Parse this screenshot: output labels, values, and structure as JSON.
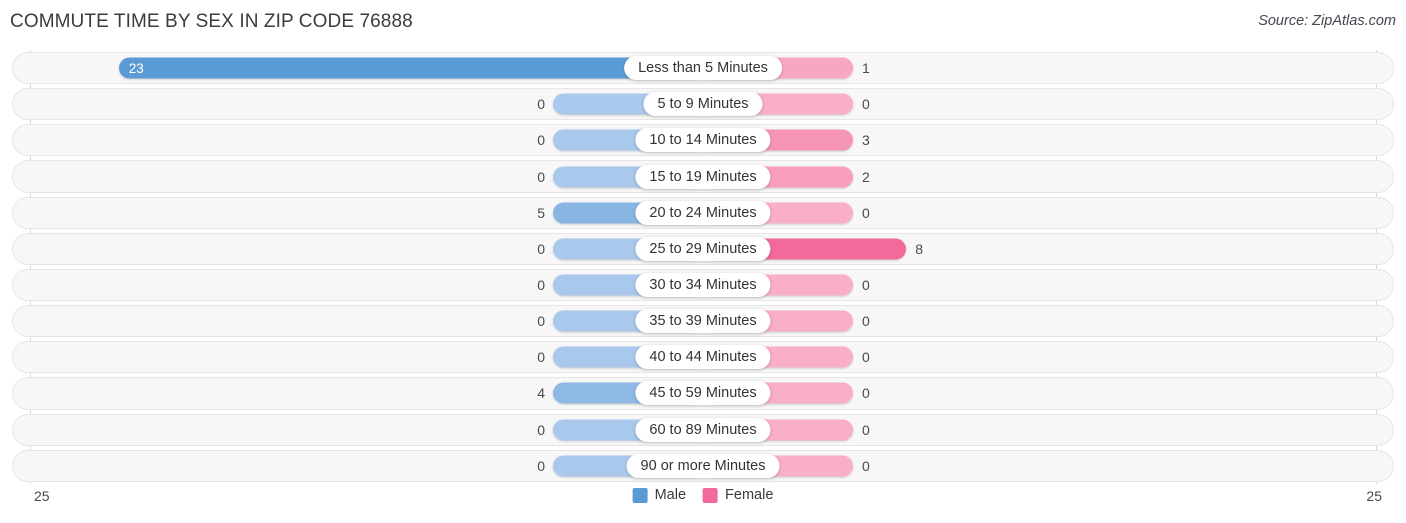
{
  "header": {
    "title": "COMMUTE TIME BY SEX IN ZIP CODE 76888",
    "source": "Source: ZipAtlas.com"
  },
  "legend": {
    "items": [
      {
        "label": "Male",
        "color": "#5B9BD5"
      },
      {
        "label": "Female",
        "color": "#F4699B"
      }
    ]
  },
  "axis": {
    "left_label": "25",
    "right_label": "25"
  },
  "colors": {
    "male_strong": "#5B9BD5",
    "male_light": "#A8C8EC",
    "female_strong": "#F4699B",
    "female_light": "#F9AFC6",
    "track_fill": "#f7f7f7",
    "track_border": "#e6e6e6",
    "gridline": "#d8d8d8"
  },
  "chart_data": {
    "type": "bar",
    "subtype": "diverging-bar",
    "title": "COMMUTE TIME BY SEX IN ZIP CODE 76888",
    "xlabel": "",
    "ylabel": "",
    "xlim": [
      25,
      25
    ],
    "axis_max_left": 25,
    "axis_max_right": 25,
    "grid": true,
    "legend_position": "bottom-center",
    "categories": [
      "Less than 5 Minutes",
      "5 to 9 Minutes",
      "10 to 14 Minutes",
      "15 to 19 Minutes",
      "20 to 24 Minutes",
      "25 to 29 Minutes",
      "30 to 34 Minutes",
      "35 to 39 Minutes",
      "40 to 44 Minutes",
      "45 to 59 Minutes",
      "60 to 89 Minutes",
      "90 or more Minutes"
    ],
    "series": [
      {
        "name": "Male",
        "color": "#5B9BD5",
        "values": [
          23,
          0,
          0,
          0,
          5,
          0,
          0,
          0,
          0,
          4,
          0,
          0
        ]
      },
      {
        "name": "Female",
        "color": "#F4699B",
        "values": [
          1,
          0,
          3,
          2,
          0,
          8,
          0,
          0,
          0,
          0,
          0,
          0
        ]
      }
    ]
  }
}
